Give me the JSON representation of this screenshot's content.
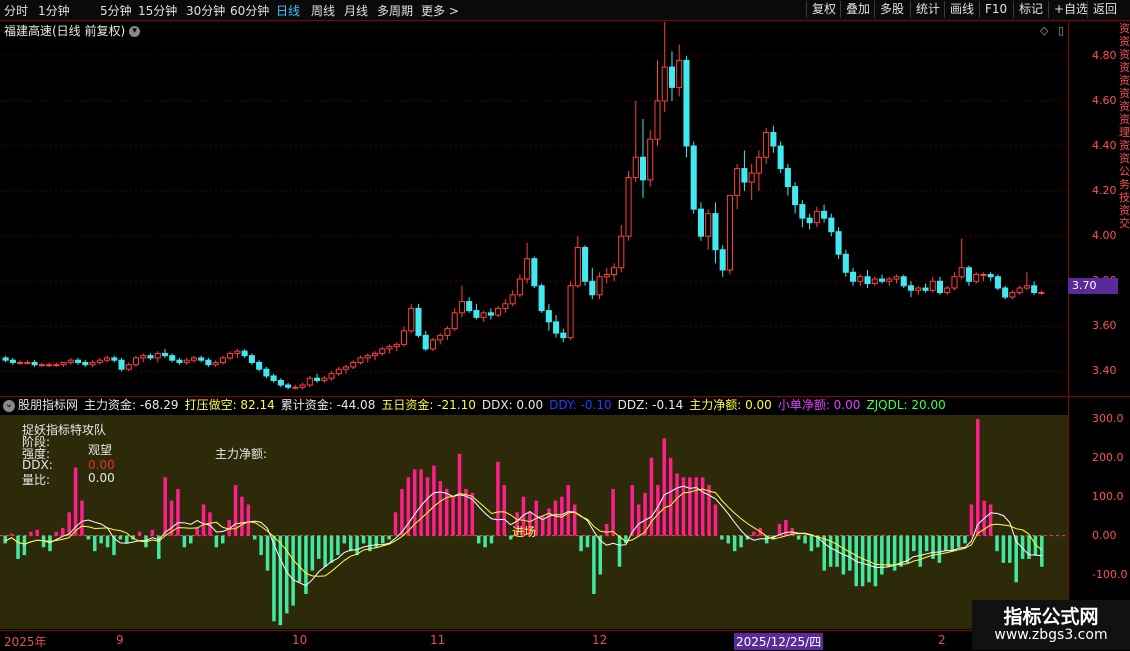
{
  "toolbar": {
    "periods": [
      "分时",
      "1分钟",
      "5分钟",
      "15分钟",
      "30分钟",
      "60分钟",
      "日线",
      "周线",
      "月线",
      "多周期",
      "更多 >"
    ],
    "active_period": "日线",
    "right_buttons": [
      "复权",
      "叠加",
      "多股",
      "统计",
      "画线",
      "F10",
      "标记",
      "+自选",
      "返回"
    ]
  },
  "chart": {
    "title": "福建高速(日线 前复权)",
    "price_labels": [
      "4.80",
      "4.60",
      "4.40",
      "4.20",
      "4.00",
      "3.80",
      "3.40"
    ],
    "price_labels_extra": "3.60",
    "current_price": "3.70",
    "right_strip_text": "资资资资资资资资理资资公务技资交"
  },
  "indicator": {
    "name": "股朋指标网",
    "values": [
      {
        "label": "主力资金: -68.29",
        "color": "#e8e8e8"
      },
      {
        "label": "打压做空: 82.14",
        "color": "#ffff40"
      },
      {
        "label": "累计资金: -44.08",
        "color": "#e8e8e8"
      },
      {
        "label": "五日资金: -21.10",
        "color": "#ffff40"
      },
      {
        "label": "DDX: 0.00",
        "color": "#e8e8e8"
      },
      {
        "label": "DDY: -0.10",
        "color": "#2040ff"
      },
      {
        "label": "DDZ: -0.14",
        "color": "#e8e8e8"
      },
      {
        "label": "主力净额: 0.00",
        "color": "#ffff40"
      },
      {
        "label": "小单净额: 0.00",
        "color": "#e040ff"
      },
      {
        "label": "ZJQDL: 20.00",
        "color": "#40ff40"
      }
    ],
    "axis_labels": [
      "300.0",
      "200.0",
      "100.0",
      "0.00",
      "-100.0"
    ],
    "info_lines": {
      "line1": "捉妖指标特攻队",
      "stage_label": "阶段:",
      "strength_label": "强度:",
      "strength_value": "观望",
      "ddx_label": "DDX:",
      "ddx_value": "0.00",
      "ratio_label": "量比:",
      "ratio_value": "0.00",
      "net_label": "主力净额:",
      "entry_label": "进场"
    }
  },
  "dates": {
    "labels": [
      "2025年",
      "9",
      "10",
      "11",
      "12",
      "2025/12/25/四",
      "2"
    ]
  },
  "watermark": {
    "title": "指标公式网",
    "url": "www.zbgs3.com"
  },
  "chart_data": {
    "type": "candlestick",
    "ylim": [
      3.3,
      4.95
    ],
    "candles": [
      [
        3.46,
        3.47,
        3.44,
        3.45
      ],
      [
        3.45,
        3.46,
        3.43,
        3.44
      ],
      [
        3.44,
        3.45,
        3.43,
        3.44
      ],
      [
        3.44,
        3.45,
        3.43,
        3.44
      ],
      [
        3.44,
        3.45,
        3.42,
        3.43
      ],
      [
        3.43,
        3.44,
        3.42,
        3.43
      ],
      [
        3.43,
        3.44,
        3.42,
        3.43
      ],
      [
        3.43,
        3.44,
        3.42,
        3.43
      ],
      [
        3.43,
        3.44,
        3.42,
        3.44
      ],
      [
        3.44,
        3.46,
        3.43,
        3.45
      ],
      [
        3.45,
        3.46,
        3.43,
        3.44
      ],
      [
        3.44,
        3.45,
        3.42,
        3.43
      ],
      [
        3.43,
        3.45,
        3.42,
        3.44
      ],
      [
        3.44,
        3.46,
        3.43,
        3.45
      ],
      [
        3.45,
        3.47,
        3.44,
        3.46
      ],
      [
        3.46,
        3.47,
        3.44,
        3.45
      ],
      [
        3.45,
        3.46,
        3.4,
        3.41
      ],
      [
        3.41,
        3.44,
        3.4,
        3.43
      ],
      [
        3.43,
        3.47,
        3.42,
        3.46
      ],
      [
        3.46,
        3.48,
        3.44,
        3.47
      ],
      [
        3.47,
        3.48,
        3.45,
        3.46
      ],
      [
        3.46,
        3.49,
        3.44,
        3.48
      ],
      [
        3.48,
        3.5,
        3.46,
        3.47
      ],
      [
        3.47,
        3.48,
        3.44,
        3.45
      ],
      [
        3.45,
        3.46,
        3.43,
        3.44
      ],
      [
        3.44,
        3.46,
        3.43,
        3.45
      ],
      [
        3.45,
        3.47,
        3.44,
        3.46
      ],
      [
        3.46,
        3.47,
        3.44,
        3.45
      ],
      [
        3.45,
        3.46,
        3.42,
        3.43
      ],
      [
        3.43,
        3.45,
        3.42,
        3.44
      ],
      [
        3.44,
        3.47,
        3.43,
        3.46
      ],
      [
        3.46,
        3.49,
        3.45,
        3.48
      ],
      [
        3.48,
        3.5,
        3.46,
        3.49
      ],
      [
        3.49,
        3.5,
        3.46,
        3.47
      ],
      [
        3.47,
        3.48,
        3.43,
        3.44
      ],
      [
        3.44,
        3.45,
        3.4,
        3.41
      ],
      [
        3.41,
        3.42,
        3.37,
        3.38
      ],
      [
        3.38,
        3.39,
        3.35,
        3.36
      ],
      [
        3.36,
        3.37,
        3.33,
        3.34
      ],
      [
        3.34,
        3.35,
        3.32,
        3.33
      ],
      [
        3.33,
        3.34,
        3.32,
        3.33
      ],
      [
        3.33,
        3.35,
        3.32,
        3.34
      ],
      [
        3.34,
        3.38,
        3.33,
        3.37
      ],
      [
        3.37,
        3.39,
        3.35,
        3.36
      ],
      [
        3.36,
        3.38,
        3.35,
        3.37
      ],
      [
        3.37,
        3.4,
        3.36,
        3.39
      ],
      [
        3.39,
        3.42,
        3.38,
        3.41
      ],
      [
        3.41,
        3.43,
        3.39,
        3.42
      ],
      [
        3.42,
        3.45,
        3.41,
        3.44
      ],
      [
        3.44,
        3.47,
        3.43,
        3.46
      ],
      [
        3.46,
        3.48,
        3.44,
        3.47
      ],
      [
        3.47,
        3.49,
        3.45,
        3.48
      ],
      [
        3.48,
        3.51,
        3.47,
        3.5
      ],
      [
        3.5,
        3.52,
        3.48,
        3.51
      ],
      [
        3.51,
        3.53,
        3.49,
        3.52
      ],
      [
        3.52,
        3.6,
        3.51,
        3.58
      ],
      [
        3.58,
        3.7,
        3.57,
        3.68
      ],
      [
        3.68,
        3.7,
        3.55,
        3.56
      ],
      [
        3.56,
        3.58,
        3.49,
        3.5
      ],
      [
        3.5,
        3.55,
        3.49,
        3.54
      ],
      [
        3.54,
        3.57,
        3.52,
        3.56
      ],
      [
        3.56,
        3.6,
        3.54,
        3.59
      ],
      [
        3.59,
        3.68,
        3.58,
        3.66
      ],
      [
        3.66,
        3.78,
        3.64,
        3.71
      ],
      [
        3.71,
        3.73,
        3.66,
        3.67
      ],
      [
        3.67,
        3.7,
        3.63,
        3.64
      ],
      [
        3.64,
        3.67,
        3.62,
        3.66
      ],
      [
        3.66,
        3.68,
        3.63,
        3.65
      ],
      [
        3.65,
        3.69,
        3.64,
        3.68
      ],
      [
        3.68,
        3.72,
        3.66,
        3.7
      ],
      [
        3.7,
        3.76,
        3.69,
        3.74
      ],
      [
        3.74,
        3.83,
        3.73,
        3.81
      ],
      [
        3.81,
        3.97,
        3.79,
        3.9
      ],
      [
        3.9,
        3.91,
        3.77,
        3.78
      ],
      [
        3.78,
        3.79,
        3.66,
        3.67
      ],
      [
        3.67,
        3.7,
        3.58,
        3.62
      ],
      [
        3.62,
        3.65,
        3.55,
        3.57
      ],
      [
        3.57,
        3.59,
        3.53,
        3.55
      ],
      [
        3.55,
        3.8,
        3.54,
        3.78
      ],
      [
        3.78,
        4.0,
        3.77,
        3.95
      ],
      [
        3.95,
        3.96,
        3.78,
        3.8
      ],
      [
        3.8,
        3.86,
        3.72,
        3.74
      ],
      [
        3.74,
        3.84,
        3.72,
        3.82
      ],
      [
        3.82,
        3.86,
        3.79,
        3.83
      ],
      [
        3.83,
        3.88,
        3.8,
        3.86
      ],
      [
        3.86,
        4.05,
        3.84,
        4.0
      ],
      [
        4.0,
        4.29,
        3.98,
        4.26
      ],
      [
        4.26,
        4.6,
        4.24,
        4.35
      ],
      [
        4.35,
        4.52,
        4.17,
        4.25
      ],
      [
        4.25,
        4.47,
        4.22,
        4.43
      ],
      [
        4.43,
        4.78,
        4.4,
        4.6
      ],
      [
        4.6,
        4.95,
        4.55,
        4.75
      ],
      [
        4.75,
        4.82,
        4.6,
        4.66
      ],
      [
        4.66,
        4.85,
        4.62,
        4.78
      ],
      [
        4.78,
        4.8,
        4.35,
        4.4
      ],
      [
        4.4,
        4.42,
        4.1,
        4.12
      ],
      [
        4.12,
        4.15,
        3.98,
        4.0
      ],
      [
        4.0,
        4.12,
        3.94,
        4.1
      ],
      [
        4.1,
        4.15,
        3.88,
        3.94
      ],
      [
        3.94,
        3.96,
        3.82,
        3.85
      ],
      [
        3.85,
        4.18,
        3.83,
        4.18
      ],
      [
        4.18,
        4.32,
        4.12,
        4.3
      ],
      [
        4.3,
        4.38,
        4.2,
        4.24
      ],
      [
        4.24,
        4.32,
        4.16,
        4.28
      ],
      [
        4.28,
        4.38,
        4.2,
        4.35
      ],
      [
        4.35,
        4.48,
        4.32,
        4.46
      ],
      [
        4.46,
        4.49,
        4.37,
        4.4
      ],
      [
        4.4,
        4.42,
        4.28,
        4.3
      ],
      [
        4.3,
        4.32,
        4.18,
        4.22
      ],
      [
        4.22,
        4.24,
        4.1,
        4.14
      ],
      [
        4.14,
        4.16,
        4.04,
        4.08
      ],
      [
        4.08,
        4.1,
        4.03,
        4.06
      ],
      [
        4.06,
        4.13,
        4.04,
        4.11
      ],
      [
        4.11,
        4.14,
        4.06,
        4.08
      ],
      [
        4.08,
        4.1,
        4.0,
        4.02
      ],
      [
        4.02,
        4.04,
        3.9,
        3.92
      ],
      [
        3.92,
        3.94,
        3.82,
        3.84
      ],
      [
        3.84,
        3.86,
        3.78,
        3.8
      ],
      [
        3.8,
        3.83,
        3.78,
        3.82
      ],
      [
        3.82,
        3.85,
        3.77,
        3.79
      ],
      [
        3.79,
        3.82,
        3.78,
        3.81
      ],
      [
        3.81,
        3.83,
        3.79,
        3.8
      ],
      [
        3.8,
        3.82,
        3.78,
        3.81
      ],
      [
        3.81,
        3.83,
        3.79,
        3.82
      ],
      [
        3.82,
        3.83,
        3.77,
        3.78
      ],
      [
        3.78,
        3.8,
        3.73,
        3.76
      ],
      [
        3.76,
        3.78,
        3.74,
        3.77
      ],
      [
        3.77,
        3.79,
        3.75,
        3.76
      ],
      [
        3.76,
        3.82,
        3.75,
        3.8
      ],
      [
        3.8,
        3.82,
        3.74,
        3.75
      ],
      [
        3.75,
        3.78,
        3.74,
        3.77
      ],
      [
        3.77,
        3.84,
        3.76,
        3.82
      ],
      [
        3.82,
        3.99,
        3.81,
        3.86
      ],
      [
        3.86,
        3.87,
        3.78,
        3.8
      ],
      [
        3.8,
        3.84,
        3.79,
        3.83
      ],
      [
        3.83,
        3.84,
        3.8,
        3.83
      ],
      [
        3.83,
        3.84,
        3.8,
        3.82
      ],
      [
        3.82,
        3.83,
        3.76,
        3.77
      ],
      [
        3.77,
        3.78,
        3.72,
        3.73
      ],
      [
        3.73,
        3.76,
        3.72,
        3.75
      ],
      [
        3.75,
        3.78,
        3.74,
        3.77
      ],
      [
        3.77,
        3.84,
        3.76,
        3.78
      ],
      [
        3.78,
        3.8,
        3.74,
        3.75
      ],
      [
        3.75,
        3.76,
        3.74,
        3.75
      ]
    ],
    "indicator_bars": [
      -20,
      5,
      -60,
      -50,
      10,
      15,
      -30,
      -40,
      10,
      20,
      60,
      175,
      90,
      -10,
      -40,
      -20,
      -30,
      -50,
      -10,
      -20,
      -10,
      10,
      -30,
      15,
      -60,
      150,
      90,
      120,
      -30,
      -20,
      20,
      80,
      60,
      -30,
      -20,
      40,
      130,
      100,
      80,
      -10,
      -50,
      -90,
      -220,
      -230,
      -200,
      -180,
      -120,
      -150,
      -90,
      -60,
      -80,
      -70,
      -50,
      -20,
      -40,
      -50,
      -20,
      -40,
      -30,
      -20,
      -10,
      60,
      120,
      150,
      170,
      170,
      150,
      180,
      140,
      120,
      100,
      210,
      120,
      110,
      -20,
      -30,
      -20,
      190,
      130,
      -10,
      60,
      100,
      60,
      90,
      50,
      70,
      90,
      100,
      130,
      80,
      -40,
      -30,
      -150,
      -100,
      30,
      120,
      -80,
      -20,
      130,
      80,
      110,
      200,
      130,
      250,
      200,
      160,
      150,
      150,
      150,
      150,
      130,
      80,
      -10,
      -20,
      -40,
      -30,
      -10,
      10,
      20,
      -20,
      -10,
      30,
      40,
      20,
      -10,
      -20,
      -40,
      -30,
      -90,
      -80,
      -80,
      -100,
      -90,
      -130,
      -130,
      -120,
      -130,
      -100,
      -80,
      -90,
      -80,
      -70,
      -40,
      -80,
      -40,
      -60,
      -70,
      -40,
      -40,
      -30,
      -20,
      80,
      300,
      90,
      80,
      -40,
      -70,
      -70,
      -120,
      -60,
      -60,
      -50,
      -80
    ]
  }
}
